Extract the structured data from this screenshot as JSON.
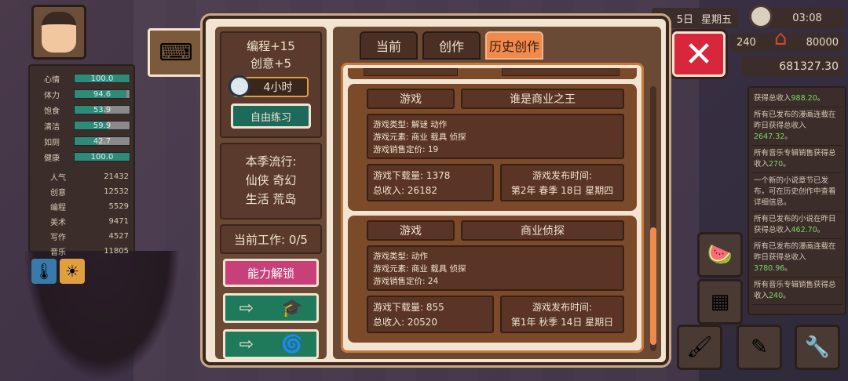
{
  "hud": {
    "date": "5日",
    "weekday": "星期五",
    "time": "03:08",
    "energy": "240",
    "house_value": "80000",
    "money": "681327.30"
  },
  "character": {
    "bars": [
      {
        "label": "心情",
        "value": "100.0",
        "fill": 1.0
      },
      {
        "label": "体力",
        "value": "94.6",
        "fill": 0.946
      },
      {
        "label": "饱食",
        "value": "53.9",
        "fill": 0.539
      },
      {
        "label": "清洁",
        "value": "59.9",
        "fill": 0.599
      },
      {
        "label": "如厕",
        "value": "42.7",
        "fill": 0.427
      },
      {
        "label": "健康",
        "value": "100.0",
        "fill": 1.0
      }
    ],
    "attrs": [
      {
        "label": "人气",
        "value": "21432"
      },
      {
        "label": "创意",
        "value": "12532"
      },
      {
        "label": "编程",
        "value": "5529"
      },
      {
        "label": "美术",
        "value": "9471"
      },
      {
        "label": "写作",
        "value": "4527"
      },
      {
        "label": "音乐",
        "value": "11805"
      }
    ]
  },
  "messages": [
    {
      "text": "获得总收入",
      "amount": "988.20",
      "suffix": "。"
    },
    {
      "text": "所有已发布的漫画连载在昨日获得总收入",
      "amount": "2647.32",
      "suffix": "。"
    },
    {
      "text": "所有音乐专辑销售获得总收入",
      "amount": "270",
      "suffix": "。"
    },
    {
      "text": "一个新的小说章节已发布，可在历史创作中查看详细信息。",
      "amount": "",
      "suffix": ""
    },
    {
      "text": "所有已发布的小说在昨日获得总收入",
      "amount": "462.70",
      "suffix": "。"
    },
    {
      "text": "所有已发布的漫画连载在昨日获得总收入",
      "amount": "3780.96",
      "suffix": "。"
    },
    {
      "text": "所有音乐专辑销售获得总收入",
      "amount": "240",
      "suffix": "。"
    }
  ],
  "left_panel": {
    "bonus1": "编程+15",
    "bonus2": "创意+5",
    "hours": "4小时",
    "practice_label": "自由练习",
    "trend_title": "本季流行:",
    "trend_line1": "仙侠 奇幻",
    "trend_line2": "生活 荒岛",
    "current_work": "当前工作: 0/5",
    "unlock_label": "能力解锁"
  },
  "tabs": [
    {
      "label": "当前"
    },
    {
      "label": "创作"
    },
    {
      "label": "历史创作"
    }
  ],
  "games": [
    {
      "category": "游戏",
      "title": "谁是商业之王",
      "type_line": "游戏类型:  解谜  动作",
      "elements_line": "游戏元素:  商业  载具  侦探",
      "price_line": "游戏销售定价: 19",
      "downloads": "游戏下载量:  1378",
      "revenue": "总收入:  26182",
      "release_label": "游戏发布时间:",
      "release_date": "第2年  春季  18日   星期四"
    },
    {
      "category": "游戏",
      "title": "商业侦探",
      "type_line": "游戏类型:  动作",
      "elements_line": "游戏元素:  商业  载具  侦探",
      "price_line": "游戏销售定价: 24",
      "downloads": "游戏下载量:  855",
      "revenue": "总收入:  20520",
      "release_label": "游戏发布时间:",
      "release_date": "第1年  秋季  14日   星期日"
    }
  ],
  "colors": {
    "dialog_bg": "#f2e4d0",
    "active_tab": "#f08a4a",
    "close_button": "#d8263a",
    "practice_button": "#1e6a5a",
    "unlock_button": "#c8407a",
    "money_highlight": "#7fd46a"
  },
  "icons": [
    "keyboard-icon",
    "clock-icon",
    "house-icon",
    "close-icon",
    "arrow-right-icon",
    "graduation-cap-icon",
    "spiral-icon",
    "thermometer-icon",
    "sun-icon"
  ]
}
